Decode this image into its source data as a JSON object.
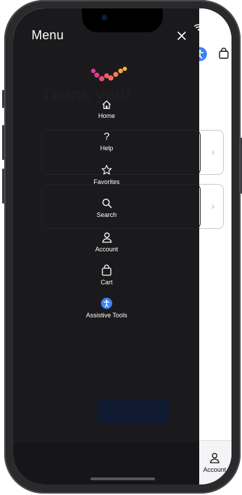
{
  "menu": {
    "title": "Menu",
    "items": [
      {
        "label": "Home",
        "icon": "home-icon"
      },
      {
        "label": "Help",
        "icon": "question-icon"
      },
      {
        "label": "Favorites",
        "icon": "star-icon"
      },
      {
        "label": "Search",
        "icon": "search-icon"
      },
      {
        "label": "Account",
        "icon": "person-icon"
      },
      {
        "label": "Cart",
        "icon": "bag-icon"
      },
      {
        "label": "Assistive Tools",
        "icon": "accessibility-icon"
      }
    ]
  },
  "background_app": {
    "heading": "Thank you!",
    "tab_account_label": "Account"
  },
  "colors": {
    "menu_bg": "#1a1a1c",
    "accent_blue": "#3b82f6",
    "logo_pink": "#e0379a",
    "logo_orange": "#f6a23b"
  }
}
